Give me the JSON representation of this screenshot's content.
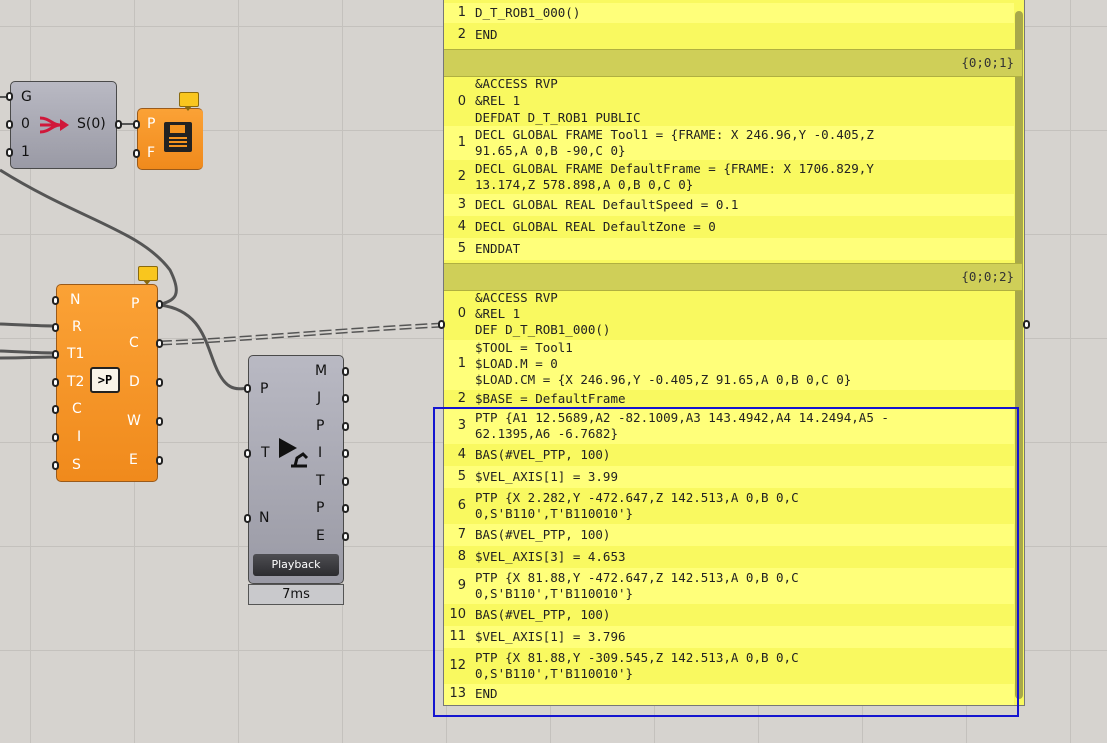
{
  "stream_filter": {
    "inputs": [
      "G",
      "0",
      "1"
    ],
    "output": "S(0)"
  },
  "data_output": {
    "inputs": [
      "P",
      "F"
    ]
  },
  "post_processor": {
    "inputs": [
      "N",
      "R",
      "T1",
      "T2",
      "C",
      "I",
      "S"
    ],
    "outputs": [
      "P",
      "C",
      "D",
      "W",
      "E"
    ],
    "icon_text": ">P"
  },
  "simulation": {
    "inputs": [
      "P",
      "T",
      "N"
    ],
    "outputs": [
      "M",
      "J",
      "P",
      "I",
      "T",
      "P",
      "E"
    ],
    "button_label": "Playback",
    "timer": "7ms"
  },
  "panel": {
    "section_a": [
      {
        "n": "1",
        "lines": [
          "D_T_ROB1_000()"
        ]
      },
      {
        "n": "2",
        "lines": [
          "END"
        ]
      }
    ],
    "header_1": "{0;0;1}",
    "section_b": [
      {
        "n": "0",
        "lines": [
          "&ACCESS RVP",
          "&REL 1",
          "DEFDAT D_T_ROB1 PUBLIC"
        ]
      },
      {
        "n": "1",
        "lines": [
          "DECL GLOBAL FRAME Tool1 = {FRAME: X 246.96,Y -0.405,Z",
          "91.65,A 0,B -90,C 0}"
        ]
      },
      {
        "n": "2",
        "lines": [
          "DECL GLOBAL FRAME DefaultFrame = {FRAME: X 1706.829,Y",
          "13.174,Z 578.898,A 0,B 0,C 0}"
        ]
      },
      {
        "n": "3",
        "lines": [
          "DECL GLOBAL REAL DefaultSpeed = 0.1"
        ]
      },
      {
        "n": "4",
        "lines": [
          "DECL GLOBAL REAL DefaultZone = 0"
        ]
      },
      {
        "n": "5",
        "lines": [
          "ENDDAT"
        ]
      }
    ],
    "header_2": "{0;0;2}",
    "section_c": [
      {
        "n": "0",
        "lines": [
          "&ACCESS RVP",
          "&REL 1",
          "DEF D_T_ROB1_000()"
        ]
      },
      {
        "n": "1",
        "lines": [
          "$TOOL = Tool1",
          "$LOAD.M = 0",
          "$LOAD.CM = {X 246.96,Y -0.405,Z 91.65,A 0,B 0,C 0}"
        ]
      },
      {
        "n": "2",
        "lines": [
          "$BASE = DefaultFrame"
        ]
      },
      {
        "n": "3",
        "lines": [
          "PTP {A1 12.5689,A2 -82.1009,A3 143.4942,A4 14.2494,A5 -",
          "62.1395,A6 -6.7682}"
        ]
      },
      {
        "n": "4",
        "lines": [
          "BAS(#VEL_PTP, 100)"
        ]
      },
      {
        "n": "5",
        "lines": [
          "$VEL_AXIS[1] = 3.99"
        ]
      },
      {
        "n": "6",
        "lines": [
          "PTP {X 2.282,Y -472.647,Z 142.513,A 0,B 0,C",
          "0,S'B110',T'B110010'}"
        ]
      },
      {
        "n": "7",
        "lines": [
          "BAS(#VEL_PTP, 100)"
        ]
      },
      {
        "n": "8",
        "lines": [
          "$VEL_AXIS[3] = 4.653"
        ]
      },
      {
        "n": "9",
        "lines": [
          "PTP {X 81.88,Y -472.647,Z 142.513,A 0,B 0,C",
          "0,S'B110',T'B110010'}"
        ]
      },
      {
        "n": "10",
        "lines": [
          "BAS(#VEL_PTP, 100)"
        ]
      },
      {
        "n": "11",
        "lines": [
          "$VEL_AXIS[1] = 3.796"
        ]
      },
      {
        "n": "12",
        "lines": [
          "PTP {X 81.88,Y -309.545,Z 142.513,A 0,B 0,C",
          "0,S'B110',T'B110010'}"
        ]
      },
      {
        "n": "13",
        "lines": [
          "END"
        ]
      }
    ]
  },
  "colors": {
    "panel_bg": "#f9f960",
    "component_grey": "#a9a9b3",
    "component_orange": "#f5941f",
    "highlight_border": "#1515d0"
  }
}
